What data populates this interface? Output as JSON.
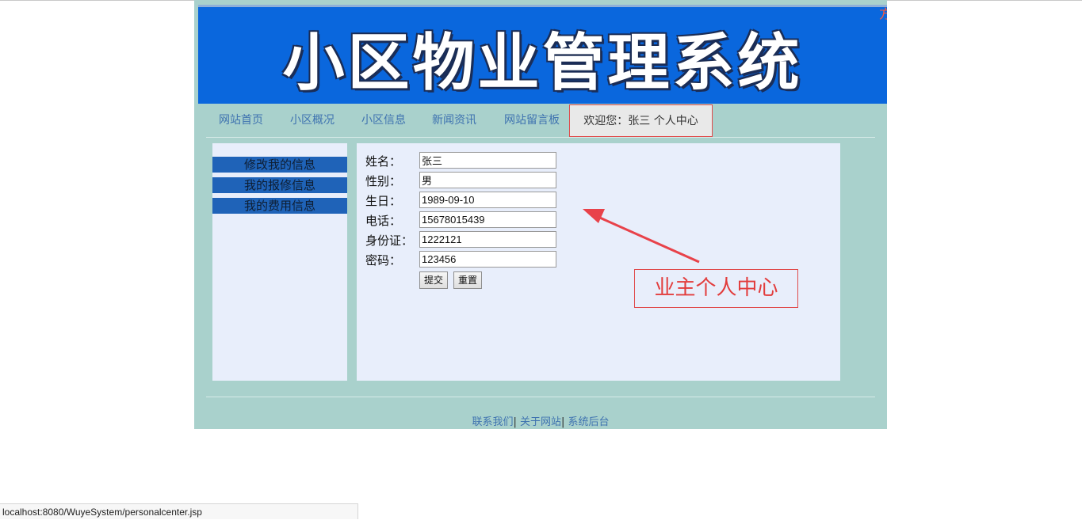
{
  "banner": {
    "title": "小区物业管理系统"
  },
  "nav": {
    "items": [
      "网站首页",
      "小区概况",
      "小区信息",
      "新闻资讯",
      "网站留言板"
    ],
    "welcome": "欢迎您：张三 个人中心"
  },
  "sidebar": {
    "items": [
      "修改我的信息",
      "我的报修信息",
      "我的费用信息"
    ]
  },
  "form": {
    "fields": [
      {
        "label": "姓名：",
        "value": "张三"
      },
      {
        "label": "性别：",
        "value": "男"
      },
      {
        "label": "生日：",
        "value": "1989-09-10"
      },
      {
        "label": "电话：",
        "value": "15678015439"
      },
      {
        "label": "身份证：",
        "value": "1222121"
      },
      {
        "label": "密码：",
        "value": "123456"
      }
    ],
    "submit": "提交",
    "reset": "重置"
  },
  "annotation": {
    "text": "业主个人中心",
    "color": "#e23c3c"
  },
  "footer": {
    "links": [
      "联系我们",
      "关于网站",
      "系统后台"
    ],
    "separator": "|"
  },
  "statusbar": {
    "url": "localhost:8080/WuyeSystem/personalcenter.jsp"
  },
  "colors": {
    "page_bg": "#a9d1cc",
    "banner_bg": "#0a67dd",
    "panel_bg": "#e8eefb",
    "sidebar_item_bg": "#1f63b8",
    "nav_link": "#3f73b0"
  }
}
